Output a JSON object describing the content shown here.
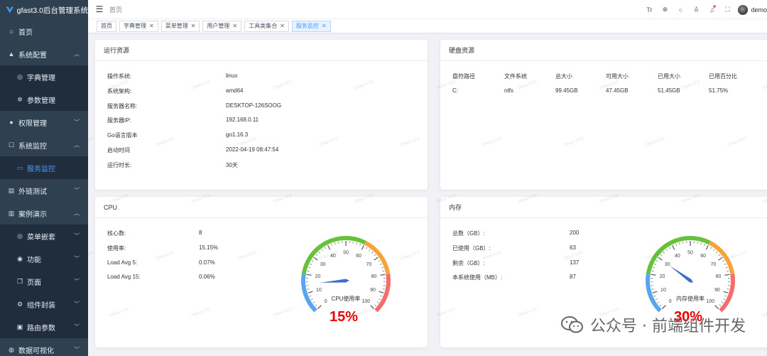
{
  "app": {
    "title": "gfast3.0后台管理系统"
  },
  "sidebar": {
    "items": [
      {
        "label": "首页",
        "icon": "home-icon"
      },
      {
        "label": "系统配置",
        "icon": "system-config-icon",
        "expanded": true
      },
      {
        "label": "字典管理",
        "icon": "dict-icon"
      },
      {
        "label": "参数管理",
        "icon": "params-icon"
      },
      {
        "label": "权限管理",
        "icon": "user-icon"
      },
      {
        "label": "系统监控",
        "icon": "monitor-icon",
        "expanded": true
      },
      {
        "label": "服务监控",
        "icon": "service-monitor-icon",
        "active": true
      },
      {
        "label": "外链测试",
        "icon": "link-icon"
      },
      {
        "label": "案例演示",
        "icon": "demo-icon",
        "expanded": true
      },
      {
        "label": "菜单嵌套",
        "icon": "nested-menu-icon"
      },
      {
        "label": "功能",
        "icon": "function-icon"
      },
      {
        "label": "页面",
        "icon": "page-icon"
      },
      {
        "label": "组件封装",
        "icon": "component-icon"
      },
      {
        "label": "路由参数",
        "icon": "route-icon"
      },
      {
        "label": "数据可视化",
        "icon": "chart-icon"
      }
    ]
  },
  "header": {
    "breadcrumb": "首页",
    "username": "demo"
  },
  "tabs": [
    {
      "label": "首页",
      "closable": false
    },
    {
      "label": "字典管理",
      "closable": true
    },
    {
      "label": "菜单管理",
      "closable": true
    },
    {
      "label": "用户管理",
      "closable": true
    },
    {
      "label": "工具类集合",
      "closable": true
    },
    {
      "label": "服务监控",
      "closable": true,
      "active": true
    }
  ],
  "run_env": {
    "title": "运行资源",
    "rows": [
      {
        "label": "操作系统:",
        "value": "linux"
      },
      {
        "label": "系统架构:",
        "value": "amd64"
      },
      {
        "label": "服务器名称:",
        "value": "DESKTOP-126SOOG"
      },
      {
        "label": "服务器IP:",
        "value": "192.168.0.11"
      },
      {
        "label": "Go语言版本",
        "value": "go1.16.3"
      },
      {
        "label": "启动时间",
        "value": "2022-04-19 08:47:54"
      },
      {
        "label": "运行时长:",
        "value": "30天"
      }
    ]
  },
  "disk": {
    "title": "硬盘资源",
    "headers": [
      "盘符路径",
      "文件系统",
      "总大小",
      "可用大小",
      "已用大小",
      "已用百分比"
    ],
    "rows": [
      [
        "C:",
        "ntfs",
        "99.45GB",
        "47.45GB",
        "51.45GB",
        "51.75%"
      ]
    ]
  },
  "cpu": {
    "title": "CPU",
    "rows": [
      {
        "label": "核心数:",
        "value": "8"
      },
      {
        "label": "使用率:",
        "value": "15.15%"
      },
      {
        "label": "Load Avg 5:",
        "value": "0.07%"
      },
      {
        "label": "Load Avg 15:",
        "value": "0.06%"
      }
    ],
    "gauge": {
      "label": "CPU使用率",
      "percent_text": "15%",
      "value": 15,
      "ticks": [
        "0",
        "10",
        "20",
        "30",
        "40",
        "50",
        "60",
        "70",
        "80",
        "90",
        "100"
      ]
    }
  },
  "memory": {
    "title": "内存",
    "rows": [
      {
        "label": "总数（GB）:",
        "value": "200"
      },
      {
        "label": "已使用（GB）:",
        "value": "63"
      },
      {
        "label": "剩余（GB）:",
        "value": "137"
      },
      {
        "label": "本系统使用（MB）:",
        "value": "87"
      }
    ],
    "gauge": {
      "label": "内存使用率",
      "percent_text": "30%",
      "value": 30,
      "ticks": [
        "0",
        "10",
        "20",
        "30",
        "40",
        "50",
        "60",
        "70",
        "80",
        "90",
        "100"
      ]
    }
  },
  "gauge_colors": {
    "low": "#58a5f0",
    "midlow": "#67c23a",
    "midhigh": "#f5a33a",
    "high": "#f56c6c",
    "pointer": "#3f6ecb"
  },
  "watermark": {
    "text": "公众号 · 前端组件开发"
  },
  "bg_watermark": "Gfast-v3.0"
}
